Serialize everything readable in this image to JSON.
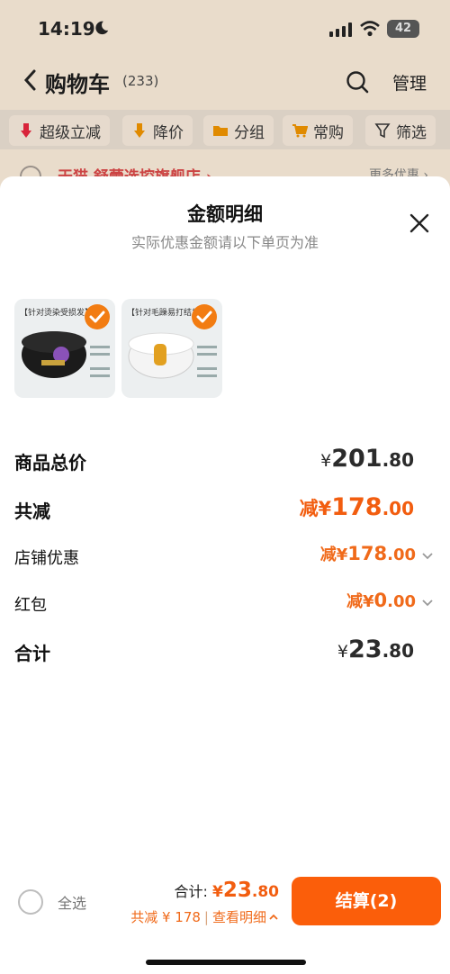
{
  "status_bar": {
    "time": "14:19",
    "battery": "42"
  },
  "nav": {
    "title": "购物车",
    "count": "(233)",
    "manage": "管理"
  },
  "filters": [
    {
      "label": "超级立减"
    },
    {
      "label": "降价"
    },
    {
      "label": "分组"
    },
    {
      "label": "常购"
    },
    {
      "label": "筛选"
    }
  ],
  "peek": {
    "store": "天猫 舒蕾选控旗舰店 ›",
    "right": "更多优惠 ›"
  },
  "sheet": {
    "title": "金额明细",
    "subtitle": "实际优惠金额请以下单页为准",
    "products": [
      {
        "tag": "【针对烫染受损发】",
        "checked": true
      },
      {
        "tag": "【针对毛躁易打结发】",
        "checked": true
      }
    ],
    "rows": {
      "goods_total": {
        "label": "商品总价",
        "yen": "¥",
        "int": "201",
        "dec": ".80"
      },
      "total_reduction": {
        "label": "共减",
        "prefix": "减¥",
        "int": "178",
        "dec": ".00"
      },
      "store_discount": {
        "label": "店铺优惠",
        "prefix": "减¥",
        "int": "178",
        "dec": ".00"
      },
      "red_packet": {
        "label": "红包",
        "prefix": "减¥",
        "int": "0",
        "dec": ".00"
      },
      "sum": {
        "label": "合计",
        "yen": "¥",
        "int": "23",
        "dec": ".80"
      }
    }
  },
  "bottom_bar": {
    "select_all": "全选",
    "total_label": "合计: ",
    "total_yen": "¥",
    "total_int": "23",
    "total_dec": ".80",
    "reduction": "共减 ¥ 178",
    "view_details": "查看明细",
    "checkout": "结算(2)"
  },
  "colors": {
    "accent": "#f25d0f",
    "checkout": "#fb5e0a",
    "check": "#f27c12"
  }
}
